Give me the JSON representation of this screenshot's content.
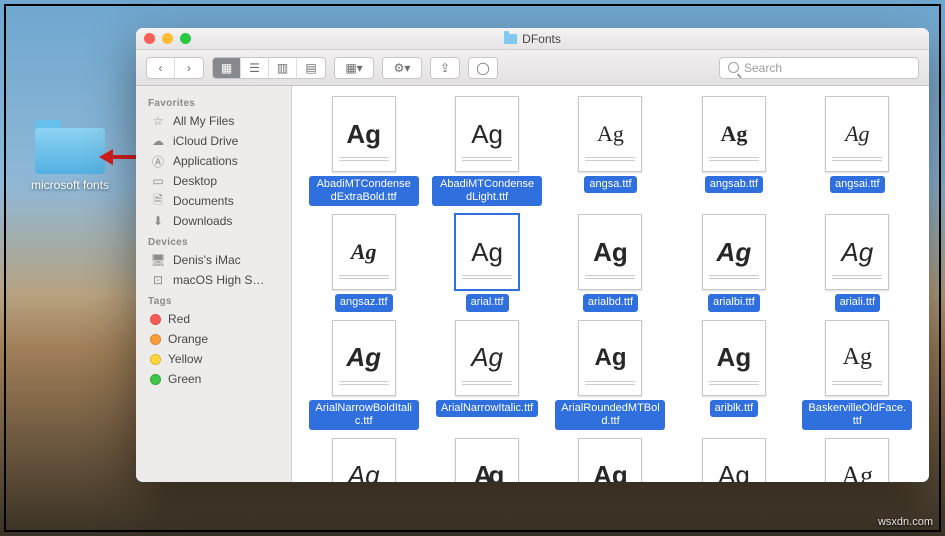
{
  "desktop": {
    "folder_label": "microsoft fonts"
  },
  "window": {
    "title": "DFonts",
    "search_placeholder": "Search",
    "sidebar": {
      "favorites_header": "Favorites",
      "favorites": [
        {
          "label": "All My Files",
          "icon": "all-files-icon"
        },
        {
          "label": "iCloud Drive",
          "icon": "cloud-icon"
        },
        {
          "label": "Applications",
          "icon": "apps-icon"
        },
        {
          "label": "Desktop",
          "icon": "desktop-icon"
        },
        {
          "label": "Documents",
          "icon": "documents-icon"
        },
        {
          "label": "Downloads",
          "icon": "downloads-icon"
        }
      ],
      "devices_header": "Devices",
      "devices": [
        {
          "label": "Denis's iMac",
          "icon": "imac-icon"
        },
        {
          "label": "macOS High S…",
          "icon": "disk-icon"
        }
      ],
      "tags_header": "Tags",
      "tags": [
        {
          "label": "Red",
          "color": "#ff5c57"
        },
        {
          "label": "Orange",
          "color": "#ff9e39"
        },
        {
          "label": "Yellow",
          "color": "#ffd639"
        },
        {
          "label": "Green",
          "color": "#3ec748"
        }
      ]
    },
    "files": [
      {
        "name": "AbadiMTCondensedExtraBold.ttf",
        "style": "font-weight:900;font-family:Arial;font-size:26px"
      },
      {
        "name": "AbadiMTCondensedLight.ttf",
        "style": "font-weight:300;font-family:Arial;font-size:26px"
      },
      {
        "name": "angsa.ttf",
        "style": "font-family:Georgia;font-size:22px"
      },
      {
        "name": "angsab.ttf",
        "style": "font-family:Georgia;font-weight:bold;font-size:22px"
      },
      {
        "name": "angsai.ttf",
        "style": "font-family:Georgia;font-style:italic;font-size:22px"
      },
      {
        "name": "angsaz.ttf",
        "style": "font-family:Georgia;font-weight:bold;font-style:italic;font-size:22px"
      },
      {
        "name": "arial.ttf",
        "style": "font-family:Arial;font-size:26px",
        "thumb_selected": true
      },
      {
        "name": "arialbd.ttf",
        "style": "font-family:Arial;font-weight:bold;font-size:26px"
      },
      {
        "name": "arialbi.ttf",
        "style": "font-family:Arial;font-weight:bold;font-style:italic;font-size:26px"
      },
      {
        "name": "ariali.ttf",
        "style": "font-family:Arial;font-style:italic;font-size:26px"
      },
      {
        "name": "ArialNarrowBoldItalic.ttf",
        "style": "font-family:'Arial Narrow',Arial;font-weight:bold;font-style:italic;font-size:26px"
      },
      {
        "name": "ArialNarrowItalic.ttf",
        "style": "font-family:'Arial Narrow',Arial;font-style:italic;font-size:26px"
      },
      {
        "name": "ArialRoundedMTBold.ttf",
        "style": "font-family:Arial;font-weight:900;font-size:24px"
      },
      {
        "name": "ariblk.ttf",
        "style": "font-family:'Arial Black',Arial;font-weight:900;font-size:26px"
      },
      {
        "name": "BaskervilleOldFace.ttf",
        "style": "font-family:Georgia;font-size:24px"
      },
      {
        "name": "",
        "style": "font-family:Arial;font-style:italic;font-size:26px",
        "partial": true
      },
      {
        "name": "",
        "style": "font-family:Arial;font-weight:900;letter-spacing:-4px;font-size:26px",
        "partial": true
      },
      {
        "name": "",
        "style": "font-family:Arial;font-weight:bold;font-size:26px",
        "partial": true
      },
      {
        "name": "",
        "style": "font-family:Arial;font-size:26px",
        "partial": true
      },
      {
        "name": "",
        "style": "font-family:Georgia;font-size:26px",
        "partial": true
      }
    ]
  },
  "watermark": "wsxdn.com"
}
